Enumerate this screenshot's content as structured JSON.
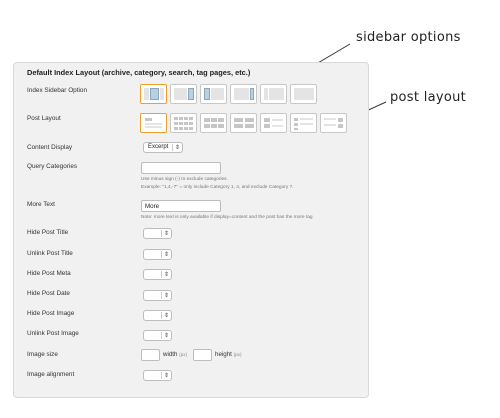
{
  "panel": {
    "title": "Default Index Layout (archive, category, search, tag pages, etc.)"
  },
  "annotations": {
    "sidebar": "sidebar options",
    "post_layout": "post layout"
  },
  "rows": {
    "sidebar_option": {
      "label": "Index Sidebar Option"
    },
    "post_layout": {
      "label": "Post Layout"
    },
    "content_display": {
      "label": "Content Display",
      "value": "Excerpt"
    },
    "query_categories": {
      "label": "Query Categories",
      "value": "",
      "note1": "Use minus sign (-) to exclude categories.",
      "note2": "Example: \"1,4,-7\" = only include Category 1, 4, and exclude Category 7."
    },
    "more_text": {
      "label": "More Text",
      "value": "More",
      "note": "Note: more text is only available if display=content and the post has the more tag"
    },
    "hide_post_title": {
      "label": "Hide Post Title",
      "value": ""
    },
    "unlink_post_title": {
      "label": "Unlink Post Title",
      "value": ""
    },
    "hide_post_meta": {
      "label": "Hide Post Meta",
      "value": ""
    },
    "hide_post_date": {
      "label": "Hide Post Date",
      "value": ""
    },
    "hide_post_image": {
      "label": "Hide Post Image",
      "value": ""
    },
    "unlink_post_image": {
      "label": "Unlink Post Image",
      "value": ""
    },
    "image_size": {
      "label": "Image size",
      "width_value": "",
      "width_label": "width",
      "width_unit": "(px)",
      "height_value": "",
      "height_label": "height",
      "height_unit": "(px)"
    },
    "image_alignment": {
      "label": "Image alignment",
      "value": ""
    }
  },
  "icons": {
    "select_arrow": "updown-arrow-icon"
  },
  "colors": {
    "selected_border": "#f0a02a",
    "panel_bg": "#f1f1f1"
  }
}
